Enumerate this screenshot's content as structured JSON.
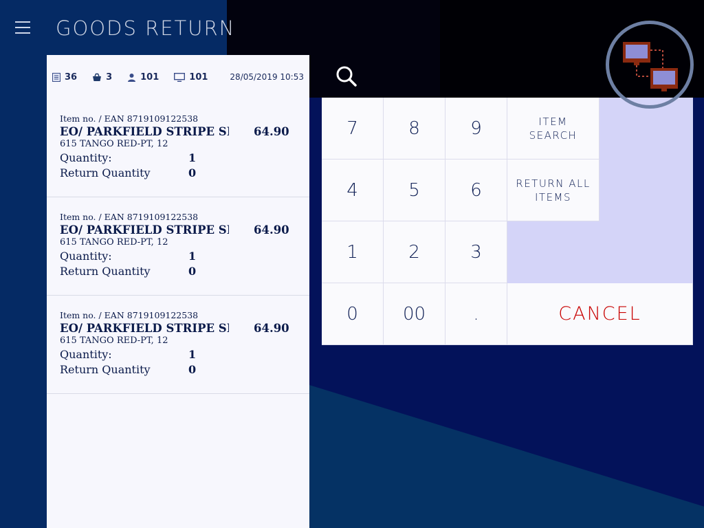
{
  "app": {
    "title": "GOODS RETURN"
  },
  "status": {
    "docs": "36",
    "basket": "3",
    "user": "101",
    "terminal": "101",
    "datetime": "28/05/2019 10:53"
  },
  "items": [
    {
      "ean": "Item no. / EAN 8719109122538",
      "name": "EO/ PARKFIELD STRIPE SHIRT",
      "price": "64.90",
      "variant": "615 TANGO RED-PT, 12",
      "qty_label": "Quantity:",
      "qty": "1",
      "ret_label": "Return Quantity",
      "ret": "0"
    },
    {
      "ean": "Item no. / EAN 8719109122538",
      "name": "EO/ PARKFIELD STRIPE SHIRT",
      "price": "64.90",
      "variant": "615 TANGO RED-PT, 12",
      "qty_label": "Quantity:",
      "qty": "1",
      "ret_label": "Return Quantity",
      "ret": "0"
    },
    {
      "ean": "Item no. / EAN 8719109122538",
      "name": "EO/ PARKFIELD STRIPE SHIRT",
      "price": "64.90",
      "variant": "615 TANGO RED-PT, 12",
      "qty_label": "Quantity:",
      "qty": "1",
      "ret_label": "Return Quantity",
      "ret": "0"
    }
  ],
  "keypad": {
    "k7": "7",
    "k8": "8",
    "k9": "9",
    "k4": "4",
    "k5": "5",
    "k6": "6",
    "k1": "1",
    "k2": "2",
    "k3": "3",
    "k0": "0",
    "k00": "00",
    "kdot": ".",
    "item_search": "ITEM SEARCH",
    "return_all": "RETURN ALL ITEMS",
    "cancel": "CANCEL"
  },
  "colors": {
    "background": "#03125a",
    "panel": "#f7f7fd",
    "keypad_fill": "#d4d4f8",
    "cancel_text": "#c80000",
    "sync_icon": "#8a2a10"
  },
  "icons": [
    "menu-icon",
    "document-icon",
    "basket-icon",
    "user-icon",
    "monitor-icon",
    "search-icon",
    "sync-terminals-icon"
  ]
}
